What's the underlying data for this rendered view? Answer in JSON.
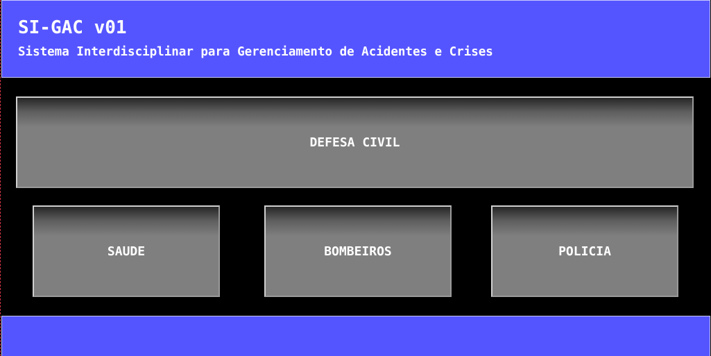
{
  "header": {
    "title": "SI-GAC v01",
    "subtitle": "Sistema Interdisciplinar para Gerenciamento de Acidentes e Crises"
  },
  "buttons": {
    "defesa_civil": "DEFESA CIVIL",
    "saude": "SAUDE",
    "bombeiros": "BOMBEIROS",
    "policia": "POLICIA"
  },
  "colors": {
    "header_bg": "#5555ff",
    "body_bg": "#000000",
    "button_bg": "#7f7f7f",
    "text": "#ffffff"
  }
}
